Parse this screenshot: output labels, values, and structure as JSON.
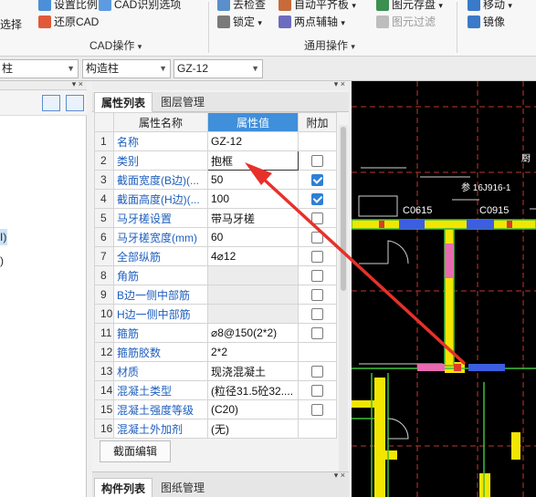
{
  "ribbon": {
    "left_group": {
      "item1": "设置比例",
      "item2": "CAD识别选项",
      "item3": "还原CAD",
      "partial_left": "选择",
      "label": "CAD操作"
    },
    "mid_group": {
      "item1": "去检查",
      "item2": "自动平齐板",
      "item3": "图元存盘",
      "item4": "锁定",
      "item5": "两点辅轴",
      "item6": "图元过滤",
      "label": "通用操作"
    },
    "right_group": {
      "item1": "移动",
      "item2": "镜像"
    }
  },
  "selector_bar": {
    "combo1": "柱",
    "combo2": "构造柱",
    "combo3": "GZ-12"
  },
  "left_panel": {
    "frag1": "I)",
    "frag2": ")"
  },
  "property_panel": {
    "tabs": [
      "属性列表",
      "图层管理"
    ],
    "headers": {
      "name": "属性名称",
      "value": "属性值",
      "extra": "附加"
    },
    "rows": [
      {
        "num": "1",
        "name": "名称",
        "value": "GZ-12",
        "check": "none"
      },
      {
        "num": "2",
        "name": "类别",
        "value": "抱框",
        "check": "off"
      },
      {
        "num": "3",
        "name": "截面宽度(B边)(...",
        "value": "50",
        "check": "on"
      },
      {
        "num": "4",
        "name": "截面高度(H边)(...",
        "value": "100",
        "check": "on"
      },
      {
        "num": "5",
        "name": "马牙槎设置",
        "value": "带马牙槎",
        "check": "off"
      },
      {
        "num": "6",
        "name": "马牙槎宽度(mm)",
        "value": "60",
        "check": "off"
      },
      {
        "num": "7",
        "name": "全部纵筋",
        "value": "4⌀12",
        "check": "off"
      },
      {
        "num": "8",
        "name": "角筋",
        "value": "",
        "check": "off"
      },
      {
        "num": "9",
        "name": "B边一侧中部筋",
        "value": "",
        "check": "off"
      },
      {
        "num": "10",
        "name": "H边一侧中部筋",
        "value": "",
        "check": "off"
      },
      {
        "num": "11",
        "name": "箍筋",
        "value": "⌀8@150(2*2)",
        "check": "off"
      },
      {
        "num": "12",
        "name": "箍筋胶数",
        "value": "2*2",
        "check": "none"
      },
      {
        "num": "13",
        "name": "材质",
        "value": "现浇混凝土",
        "check": "off"
      },
      {
        "num": "14",
        "name": "混凝土类型",
        "value": "(粒径31.5砼32....",
        "check": "off"
      },
      {
        "num": "15",
        "name": "混凝土强度等级",
        "value": "(C20)",
        "check": "off"
      },
      {
        "num": "16",
        "name": "混凝土外加剂",
        "value": "(无)",
        "check": "none"
      }
    ],
    "edit_button": "截面编辑",
    "bottom_tabs": [
      "构件列表",
      "图纸管理"
    ]
  },
  "canvas": {
    "labels": [
      "C0615",
      "C0915",
      "参 16J916-1",
      "厨"
    ]
  },
  "colors": {
    "accent_header": "#3f8fdb",
    "checkbox_on": "#2e7fd6",
    "wall_yellow": "#f2e600",
    "arrow_red": "#e8302a"
  }
}
